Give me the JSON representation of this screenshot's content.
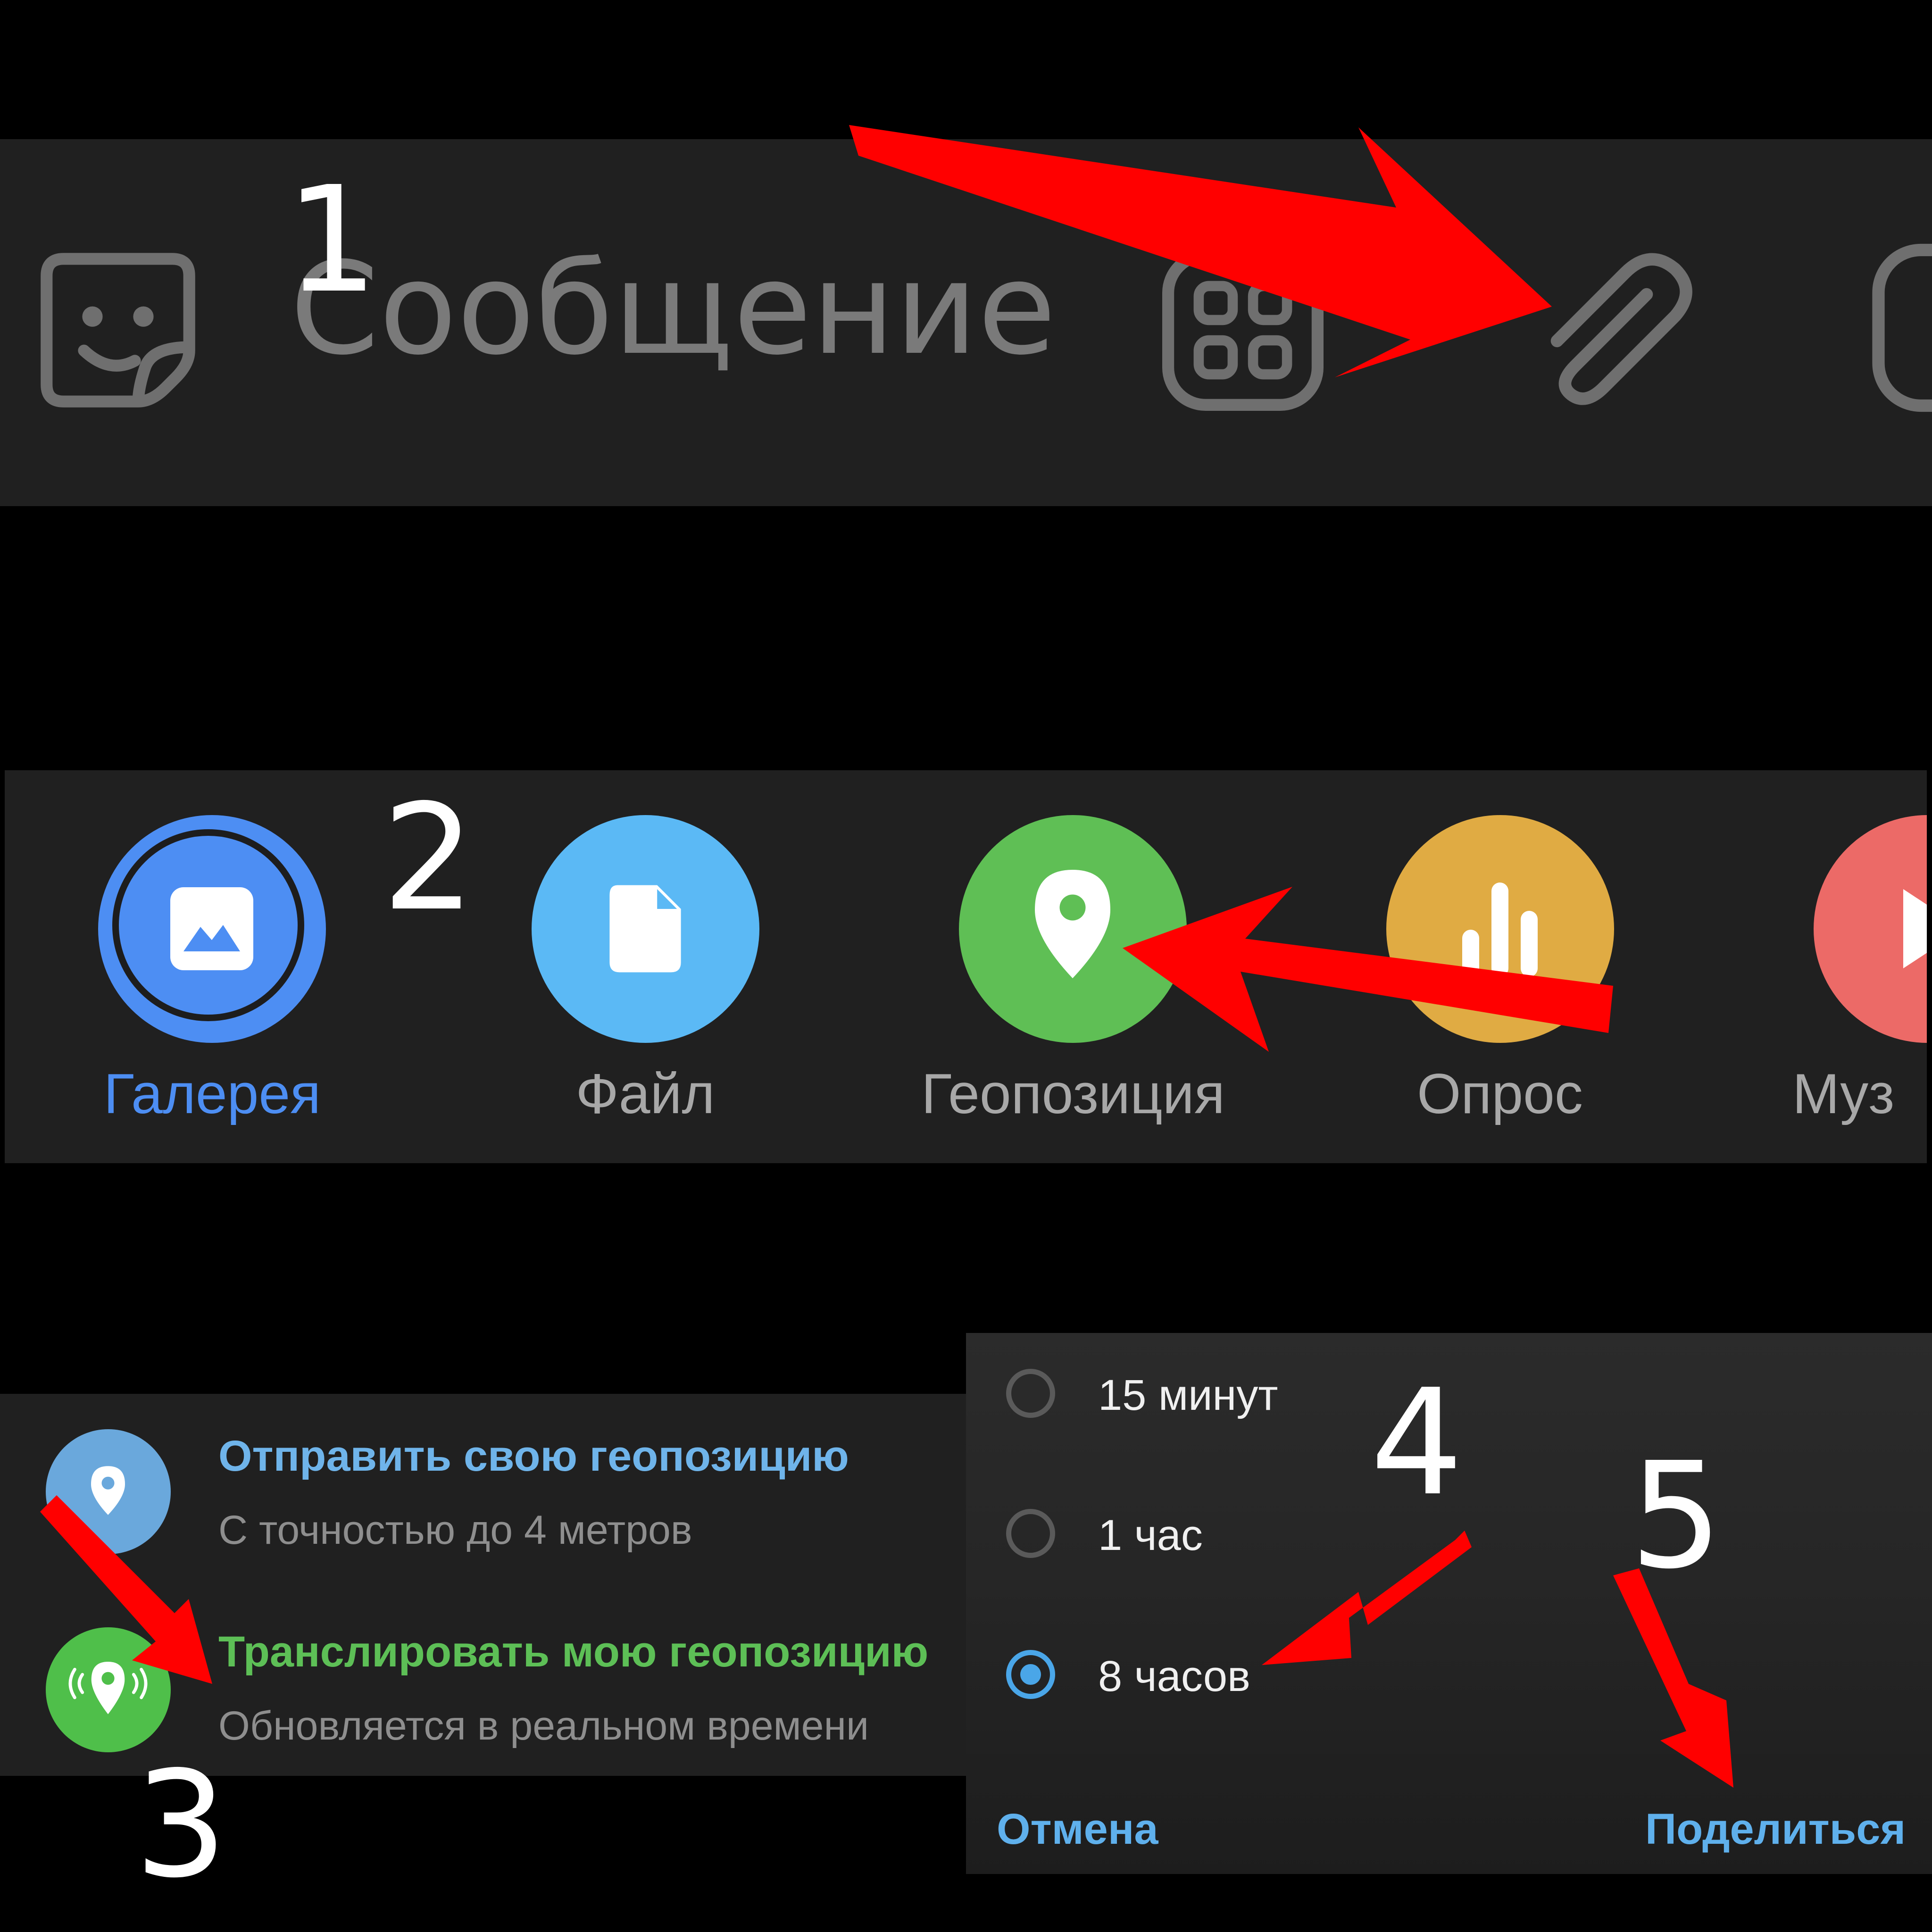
{
  "input_bar": {
    "placeholder": "Сообщение",
    "icons": [
      "sticker-icon",
      "apps-grid-icon",
      "paperclip-icon",
      "camera-icon"
    ]
  },
  "attach_menu": {
    "items": [
      {
        "label": "Галерея",
        "color": "#4d8ef3",
        "icon": "gallery-icon",
        "selected": true
      },
      {
        "label": "Файл",
        "color": "#5bb9f5",
        "icon": "file-icon"
      },
      {
        "label": "Геопозиция",
        "color": "#5fbf55",
        "icon": "location-pin-icon"
      },
      {
        "label": "Опрос",
        "color": "#e0ab43",
        "icon": "poll-icon"
      },
      {
        "label": "Муз",
        "color": "#ec6a67",
        "icon": "music-play-icon"
      }
    ],
    "selected_label_color": "#4d8ef3"
  },
  "location_options": {
    "send": {
      "title": "Отправить свою геопозицию",
      "subtitle": "С точностью до 4 метров",
      "title_color": "#6fb4ea",
      "icon_color": "#6aa8dc"
    },
    "live": {
      "title": "Транслировать мою геопозицию",
      "subtitle": "Обновляется в реальном времени",
      "title_color": "#5dbf56",
      "icon_color": "#4fbf4a"
    }
  },
  "duration_dialog": {
    "options": [
      {
        "label": "15 минут",
        "checked": false
      },
      {
        "label": "1 час",
        "checked": false
      },
      {
        "label": "8 часов",
        "checked": true
      }
    ],
    "cancel": "Отмена",
    "share": "Поделиться",
    "accent": "#4aa6e8"
  },
  "steps": [
    "1",
    "2",
    "3",
    "4",
    "5"
  ],
  "annotation_color": "#ff0000"
}
